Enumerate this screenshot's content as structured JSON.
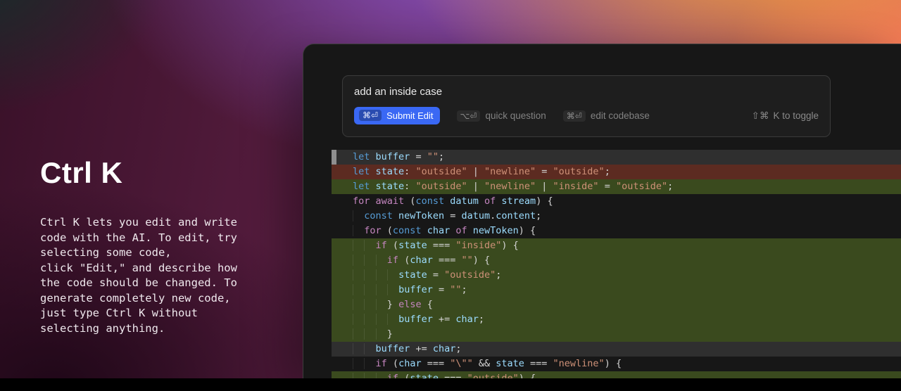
{
  "hero": {
    "title": "Ctrl K",
    "description": "Ctrl K lets you edit and write\ncode with the AI. To edit, try\nselecting some code,\nclick \"Edit,\" and describe how\nthe code should be changed. To\ngenerate completely new code,\njust type Ctrl K without\nselecting anything."
  },
  "editor": {
    "prompt": {
      "input_text": "add an inside case",
      "actions": [
        {
          "keys": "⌘⏎",
          "label": "Submit Edit"
        },
        {
          "keys": "⌥⏎",
          "label": "quick question"
        },
        {
          "keys": "⌘⏎",
          "label": "edit codebase"
        }
      ],
      "toggle_hint": {
        "keys": "⇧⌘",
        "label": "K to toggle"
      }
    },
    "code_lines": [
      {
        "bg": "gray",
        "marker": true,
        "indent": 0,
        "tokens": [
          [
            "kw",
            "let"
          ],
          [
            "plain",
            " "
          ],
          [
            "var",
            "buffer"
          ],
          [
            "plain",
            " = "
          ],
          [
            "str",
            "\"\""
          ],
          [
            "plain",
            ";"
          ]
        ]
      },
      {
        "bg": "removed",
        "indent": 0,
        "tokens": [
          [
            "kw",
            "let"
          ],
          [
            "plain",
            " "
          ],
          [
            "var",
            "state"
          ],
          [
            "plain",
            ": "
          ],
          [
            "str",
            "\"outside\""
          ],
          [
            "plain",
            " | "
          ],
          [
            "str",
            "\"newline\""
          ],
          [
            "plain",
            " = "
          ],
          [
            "str",
            "\"outside\""
          ],
          [
            "plain",
            ";"
          ]
        ]
      },
      {
        "bg": "added",
        "indent": 0,
        "tokens": [
          [
            "kw",
            "let"
          ],
          [
            "plain",
            " "
          ],
          [
            "var",
            "state"
          ],
          [
            "plain",
            ": "
          ],
          [
            "str",
            "\"outside\""
          ],
          [
            "plain",
            " | "
          ],
          [
            "str",
            "\"newline\""
          ],
          [
            "plain",
            " | "
          ],
          [
            "str",
            "\"inside\""
          ],
          [
            "plain",
            " = "
          ],
          [
            "str",
            "\"outside\""
          ],
          [
            "plain",
            ";"
          ]
        ]
      },
      {
        "bg": "none",
        "indent": 0,
        "tokens": [
          [
            "ctrl",
            "for"
          ],
          [
            "plain",
            " "
          ],
          [
            "ctrl",
            "await"
          ],
          [
            "plain",
            " ("
          ],
          [
            "kw",
            "const"
          ],
          [
            "plain",
            " "
          ],
          [
            "var",
            "datum"
          ],
          [
            "plain",
            " "
          ],
          [
            "ctrl",
            "of"
          ],
          [
            "plain",
            " "
          ],
          [
            "var",
            "stream"
          ],
          [
            "plain",
            ") {"
          ]
        ]
      },
      {
        "bg": "none",
        "indent": 1,
        "tokens": [
          [
            "kw",
            "const"
          ],
          [
            "plain",
            " "
          ],
          [
            "var",
            "newToken"
          ],
          [
            "plain",
            " = "
          ],
          [
            "var",
            "datum"
          ],
          [
            "plain",
            "."
          ],
          [
            "var",
            "content"
          ],
          [
            "plain",
            ";"
          ]
        ]
      },
      {
        "bg": "none",
        "indent": 1,
        "tokens": [
          [
            "ctrl",
            "for"
          ],
          [
            "plain",
            " ("
          ],
          [
            "kw",
            "const"
          ],
          [
            "plain",
            " "
          ],
          [
            "var",
            "char"
          ],
          [
            "plain",
            " "
          ],
          [
            "ctrl",
            "of"
          ],
          [
            "plain",
            " "
          ],
          [
            "var",
            "newToken"
          ],
          [
            "plain",
            ") {"
          ]
        ]
      },
      {
        "bg": "added",
        "indent": 2,
        "tokens": [
          [
            "ctrl",
            "if"
          ],
          [
            "plain",
            " ("
          ],
          [
            "var",
            "state"
          ],
          [
            "plain",
            " === "
          ],
          [
            "str",
            "\"inside\""
          ],
          [
            "plain",
            ") {"
          ]
        ]
      },
      {
        "bg": "added",
        "indent": 3,
        "tokens": [
          [
            "ctrl",
            "if"
          ],
          [
            "plain",
            " ("
          ],
          [
            "var",
            "char"
          ],
          [
            "plain",
            " === "
          ],
          [
            "str",
            "\"\""
          ],
          [
            "plain",
            ") {"
          ]
        ]
      },
      {
        "bg": "added",
        "indent": 4,
        "tokens": [
          [
            "var",
            "state"
          ],
          [
            "plain",
            " = "
          ],
          [
            "str",
            "\"outside\""
          ],
          [
            "plain",
            ";"
          ]
        ]
      },
      {
        "bg": "added",
        "indent": 4,
        "tokens": [
          [
            "var",
            "buffer"
          ],
          [
            "plain",
            " = "
          ],
          [
            "str",
            "\"\""
          ],
          [
            "plain",
            ";"
          ]
        ]
      },
      {
        "bg": "added",
        "indent": 3,
        "tokens": [
          [
            "plain",
            "} "
          ],
          [
            "ctrl",
            "else"
          ],
          [
            "plain",
            " {"
          ]
        ]
      },
      {
        "bg": "added",
        "indent": 4,
        "tokens": [
          [
            "var",
            "buffer"
          ],
          [
            "plain",
            " += "
          ],
          [
            "var",
            "char"
          ],
          [
            "plain",
            ";"
          ]
        ]
      },
      {
        "bg": "added",
        "indent": 3,
        "tokens": [
          [
            "plain",
            "}"
          ]
        ]
      },
      {
        "bg": "gray",
        "indent": 2,
        "tokens": [
          [
            "var",
            "buffer"
          ],
          [
            "plain",
            " += "
          ],
          [
            "var",
            "char"
          ],
          [
            "plain",
            ";"
          ]
        ]
      },
      {
        "bg": "none",
        "indent": 2,
        "tokens": [
          [
            "ctrl",
            "if"
          ],
          [
            "plain",
            " ("
          ],
          [
            "var",
            "char"
          ],
          [
            "plain",
            " === "
          ],
          [
            "str",
            "\"\\\"\""
          ],
          [
            "plain",
            " && "
          ],
          [
            "var",
            "state"
          ],
          [
            "plain",
            " === "
          ],
          [
            "str",
            "\"newline\""
          ],
          [
            "plain",
            ") {"
          ]
        ]
      },
      {
        "bg": "added",
        "indent": 3,
        "tokens": [
          [
            "ctrl",
            "if"
          ],
          [
            "plain",
            " ("
          ],
          [
            "var",
            "state"
          ],
          [
            "plain",
            " === "
          ],
          [
            "str",
            "\"outside\""
          ],
          [
            "plain",
            ") {"
          ]
        ]
      }
    ]
  },
  "colors": {
    "accent_blue": "#3a68f4",
    "diff_added_bg": "#3a4a1e",
    "diff_removed_bg": "#5c2b21",
    "line_highlight_bg": "#2f2f2f",
    "gradient_orange": "#ffae3c",
    "gradient_purple": "#8a55c8",
    "gradient_magenta": "#8a3263"
  }
}
